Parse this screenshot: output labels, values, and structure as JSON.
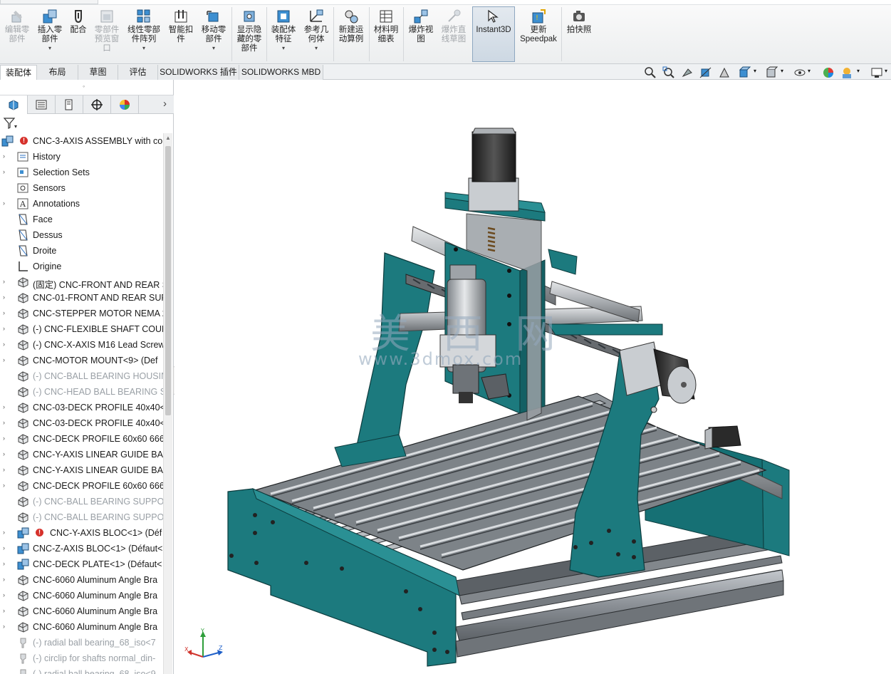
{
  "ribbon": {
    "buttons": [
      {
        "label": "编辑零\n部件",
        "icon": "edit-component-icon",
        "disabled": true,
        "drop": false
      },
      {
        "label": "插入零\n部件",
        "icon": "insert-component-icon",
        "disabled": false,
        "drop": true
      },
      {
        "label": "配合",
        "icon": "mate-icon",
        "disabled": false,
        "drop": false
      },
      {
        "label": "零部件\n预览窗\n口",
        "icon": "component-preview-icon",
        "disabled": true,
        "drop": false
      },
      {
        "label": "线性零部\n件阵列",
        "icon": "linear-pattern-icon",
        "disabled": false,
        "drop": true
      },
      {
        "label": "智能扣\n件",
        "icon": "smart-fastener-icon",
        "disabled": false,
        "drop": false
      },
      {
        "label": "移动零\n部件",
        "icon": "move-component-icon",
        "disabled": false,
        "drop": true
      },
      {
        "label": "显示隐\n藏的零\n部件",
        "icon": "show-hidden-icon",
        "disabled": false,
        "drop": false
      },
      {
        "label": "装配体\n特征",
        "icon": "assembly-feature-icon",
        "disabled": false,
        "drop": true
      },
      {
        "label": "参考几\n何体",
        "icon": "reference-geometry-icon",
        "disabled": false,
        "drop": true
      },
      {
        "label": "新建运\n动算例",
        "icon": "motion-study-icon",
        "disabled": false,
        "drop": false
      },
      {
        "label": "材料明\n细表",
        "icon": "bom-icon",
        "disabled": false,
        "drop": false
      },
      {
        "label": "爆炸视\n图",
        "icon": "exploded-view-icon",
        "disabled": false,
        "drop": false
      },
      {
        "label": "爆炸直\n线草图",
        "icon": "explode-line-sketch-icon",
        "disabled": true,
        "drop": false
      },
      {
        "label": "Instant3D",
        "icon": "instant3d-icon",
        "disabled": false,
        "drop": false,
        "active": true
      },
      {
        "label": "更新\nSpeedpak",
        "icon": "speedpak-icon",
        "disabled": false,
        "drop": false
      },
      {
        "label": "拍快照",
        "icon": "snapshot-icon",
        "disabled": false,
        "drop": false
      }
    ]
  },
  "tabs": [
    "装配体",
    "布局",
    "草图",
    "评估",
    "SOLIDWORKS 插件",
    "SOLIDWORKS MBD"
  ],
  "tree": {
    "root": "CNC-3-AXIS ASSEMBLY with co",
    "items": [
      {
        "label": "History",
        "icon": "history-icon",
        "expand": true,
        "dim": false,
        "err": false
      },
      {
        "label": "Selection Sets",
        "icon": "selection-sets-icon",
        "expand": true,
        "dim": false,
        "err": false
      },
      {
        "label": "Sensors",
        "icon": "sensors-icon",
        "expand": false,
        "dim": false,
        "err": false
      },
      {
        "label": "Annotations",
        "icon": "annotations-icon",
        "expand": true,
        "dim": false,
        "err": false
      },
      {
        "label": "Face",
        "icon": "plane-icon",
        "expand": false,
        "dim": false,
        "err": false
      },
      {
        "label": "Dessus",
        "icon": "plane-icon",
        "expand": false,
        "dim": false,
        "err": false
      },
      {
        "label": "Droite",
        "icon": "plane-icon",
        "expand": false,
        "dim": false,
        "err": false
      },
      {
        "label": "Origine",
        "icon": "origin-icon",
        "expand": false,
        "dim": false,
        "err": false
      },
      {
        "label": "(固定) CNC-FRONT AND REAR S",
        "icon": "part-icon",
        "expand": true,
        "dim": false,
        "err": false
      },
      {
        "label": "CNC-01-FRONT AND REAR SUP",
        "icon": "part-icon",
        "expand": true,
        "dim": false,
        "err": false
      },
      {
        "label": "CNC-STEPPER MOTOR NEMA 2",
        "icon": "part-icon",
        "expand": true,
        "dim": false,
        "err": false
      },
      {
        "label": "(-) CNC-FLEXIBLE SHAFT COUPL",
        "icon": "part-icon",
        "expand": true,
        "dim": false,
        "err": false
      },
      {
        "label": "(-) CNC-X-AXIS M16 Lead Screw",
        "icon": "part-icon",
        "expand": true,
        "dim": false,
        "err": false
      },
      {
        "label": "CNC-MOTOR MOUNT<9> (Def",
        "icon": "part-icon",
        "expand": true,
        "dim": false,
        "err": false
      },
      {
        "label": "(-) CNC-BALL BEARING HOUSIN",
        "icon": "part-icon",
        "expand": false,
        "dim": true,
        "err": false
      },
      {
        "label": "(-) CNC-HEAD BALL BEARING S",
        "icon": "part-icon",
        "expand": false,
        "dim": true,
        "err": false
      },
      {
        "label": "CNC-03-DECK PROFILE 40x40<",
        "icon": "part-icon",
        "expand": true,
        "dim": false,
        "err": false
      },
      {
        "label": "CNC-03-DECK PROFILE 40x40<",
        "icon": "part-icon",
        "expand": true,
        "dim": false,
        "err": false
      },
      {
        "label": "CNC-DECK PROFILE 60x60 666r",
        "icon": "part-icon",
        "expand": true,
        "dim": false,
        "err": false
      },
      {
        "label": "CNC-Y-AXIS LINEAR GUIDE BAF",
        "icon": "part-icon",
        "expand": true,
        "dim": false,
        "err": false
      },
      {
        "label": "CNC-Y-AXIS LINEAR GUIDE BAF",
        "icon": "part-icon",
        "expand": true,
        "dim": false,
        "err": false
      },
      {
        "label": "CNC-DECK PROFILE 60x60 666r",
        "icon": "part-icon",
        "expand": true,
        "dim": false,
        "err": false
      },
      {
        "label": "(-) CNC-BALL BEARING SUPPOF",
        "icon": "part-icon",
        "expand": false,
        "dim": true,
        "err": false
      },
      {
        "label": "(-) CNC-BALL BEARING SUPPOF",
        "icon": "part-icon",
        "expand": false,
        "dim": true,
        "err": false
      },
      {
        "label": "CNC-Y-AXIS BLOC<1> (Déf",
        "icon": "assembly-icon",
        "expand": true,
        "dim": false,
        "err": true
      },
      {
        "label": "CNC-Z-AXIS BLOC<1> (Défaut<",
        "icon": "assembly-icon",
        "expand": true,
        "dim": false,
        "err": false
      },
      {
        "label": "CNC-DECK PLATE<1> (Défaut<",
        "icon": "assembly-icon",
        "expand": true,
        "dim": false,
        "err": false
      },
      {
        "label": "CNC-6060 Aluminum Angle Bra",
        "icon": "part-icon",
        "expand": true,
        "dim": false,
        "err": false
      },
      {
        "label": "CNC-6060 Aluminum Angle Bra",
        "icon": "part-icon",
        "expand": true,
        "dim": false,
        "err": false
      },
      {
        "label": "CNC-6060 Aluminum Angle Bra",
        "icon": "part-icon",
        "expand": true,
        "dim": false,
        "err": false
      },
      {
        "label": "CNC-6060 Aluminum Angle Bra",
        "icon": "part-icon",
        "expand": true,
        "dim": false,
        "err": false
      },
      {
        "label": "(-) radial ball bearing_68_iso<7",
        "icon": "toolbox-part-icon",
        "expand": false,
        "dim": true,
        "err": false
      },
      {
        "label": "(-) circlip for shafts normal_din-",
        "icon": "toolbox-part-icon",
        "expand": false,
        "dim": true,
        "err": false
      },
      {
        "label": "(-) radial ball bearing_68_iso<9",
        "icon": "toolbox-part-icon",
        "expand": false,
        "dim": true,
        "err": false
      }
    ]
  },
  "viewport": {
    "watermark_cn": "美 西 网",
    "watermark_url": "www.3dmox.com",
    "triad": {
      "x": "X",
      "y": "Y",
      "z": "Z"
    }
  },
  "colors": {
    "frame_teal": "#1c7a7e",
    "accent_blue": "#2a6fc0",
    "error_red": "#d6312b"
  }
}
